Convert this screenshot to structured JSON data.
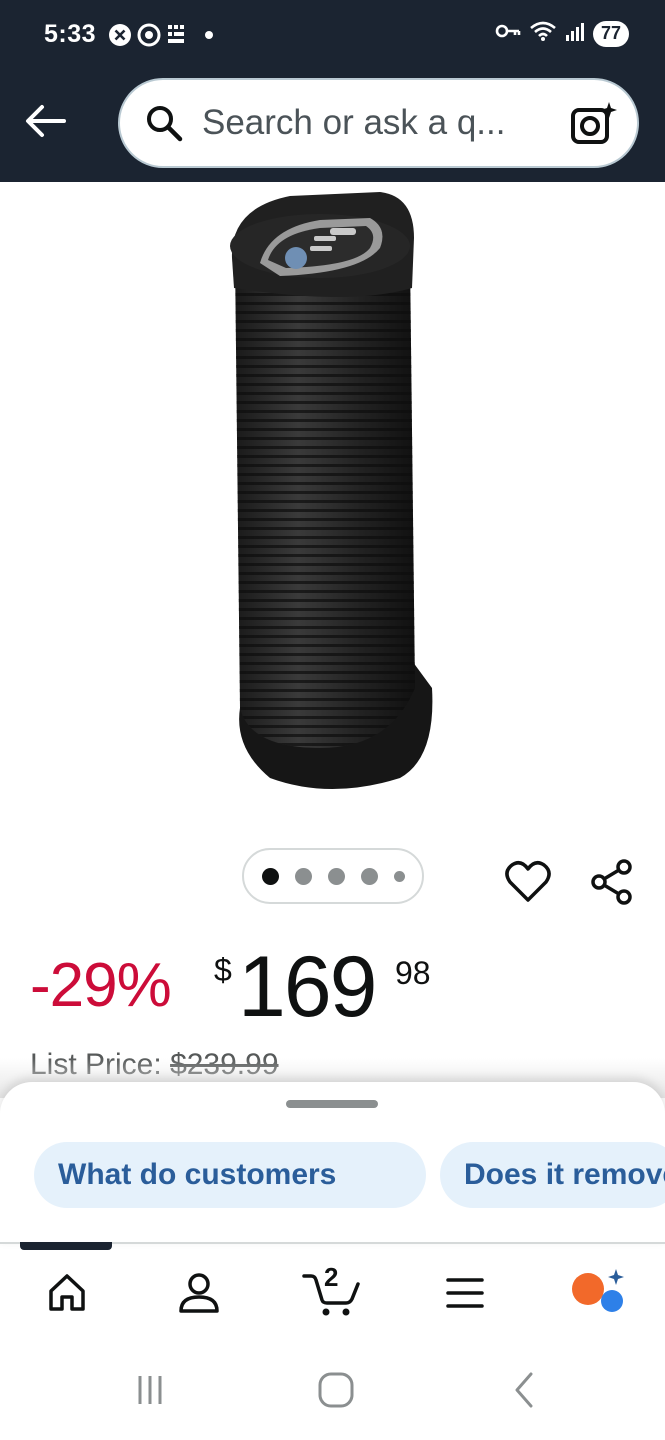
{
  "status_bar": {
    "time": "5:33",
    "battery": "77"
  },
  "header": {
    "search_placeholder": "Search or ask a q..."
  },
  "gallery": {
    "dots": [
      "active",
      "inactive",
      "inactive",
      "inactive",
      "small"
    ]
  },
  "price": {
    "discount": "-29%",
    "currency": "$",
    "whole": "169",
    "fraction": "98",
    "list_label": "List Price:",
    "list_value": "$239.99"
  },
  "suggestions": [
    "What do customers",
    "Does it remove"
  ],
  "bottom_nav": {
    "cart_count": "2",
    "items": [
      "home-icon",
      "account-icon",
      "cart-icon",
      "menu-icon",
      "rufus-icon"
    ]
  },
  "colors": {
    "header_bg": "#1b2431",
    "discount": "#cc0c39",
    "chip_bg": "#e5f1fb",
    "chip_text": "#2a5d9a"
  }
}
